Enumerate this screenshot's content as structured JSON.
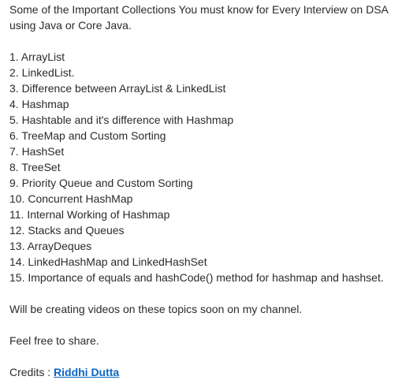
{
  "post": {
    "intro": [
      "Some of the Important Collections You must know for Every Interview on DSA",
      "using Java or Core Java."
    ],
    "items": [
      "1. ArrayList",
      "2. LinkedList.",
      "3. Difference between ArrayList & LinkedList",
      "4. Hashmap",
      "5. Hashtable and it's difference with Hashmap",
      "6. TreeMap and Custom Sorting",
      "7. HashSet",
      "8. TreeSet",
      "9. Priority Queue and Custom Sorting",
      "10. Concurrent HashMap",
      "11. Internal Working of Hashmap",
      "12. Stacks and Queues",
      "13. ArrayDeques",
      "14. LinkedHashMap and LinkedHashSet",
      "15. Importance of equals and hashCode() method for hashmap and hashset."
    ],
    "videos_note": "Will be creating videos on these topics soon on my channel.",
    "share_note": "Feel free to share.",
    "credits_label": "Credits : ",
    "credits_name": "Riddhi Dutta"
  }
}
